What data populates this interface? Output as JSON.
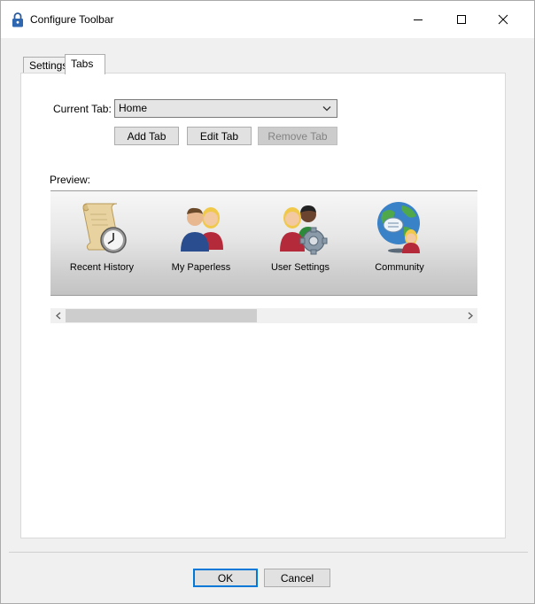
{
  "window": {
    "title": "Configure Toolbar",
    "icons": {
      "app": "lock-icon",
      "minimize": "minimize-icon",
      "maximize": "maximize-icon",
      "close": "close-icon"
    }
  },
  "tabs": [
    {
      "label": "Settings",
      "active": false
    },
    {
      "label": "Tabs",
      "active": true
    }
  ],
  "current_tab": {
    "label": "Current Tab:",
    "value": "Home"
  },
  "buttons": {
    "add_tab": "Add Tab",
    "edit_tab": "Edit Tab",
    "remove_tab": "Remove Tab"
  },
  "preview": {
    "label": "Preview:",
    "items": [
      {
        "label": "Recent History",
        "icon": "recent-history-icon"
      },
      {
        "label": "My Paperless",
        "icon": "my-paperless-icon"
      },
      {
        "label": "User Settings",
        "icon": "user-settings-icon"
      },
      {
        "label": "Community",
        "icon": "community-icon"
      }
    ]
  },
  "dialog_buttons": {
    "ok": "OK",
    "cancel": "Cancel"
  },
  "colors": {
    "focus_border": "#0078d7"
  }
}
